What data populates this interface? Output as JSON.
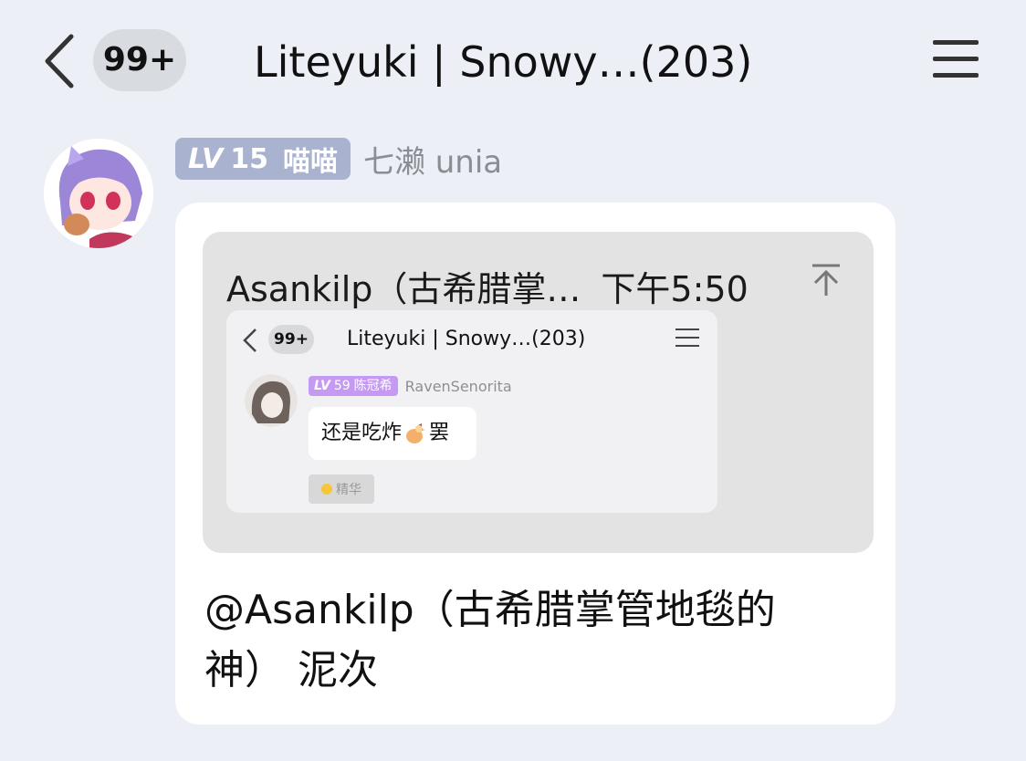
{
  "header": {
    "unread_badge": "99+",
    "title": "Liteyuki | Snowy…(203)"
  },
  "message": {
    "level": "LV",
    "level_num": "15",
    "member_title": "喵喵",
    "sender_name": "七濑 unia",
    "quote": {
      "author": "Asankilp（古希腊掌…",
      "time": "下午5:50",
      "screenshot": {
        "unread_badge": "99+",
        "title": "Liteyuki | Snowy…(203)",
        "level": "LV",
        "level_num": "59",
        "member_title": "陈冠希",
        "sender_name": "RavenSenorita",
        "text_before": "还是吃炸",
        "text_after": "罢",
        "tag": "精华"
      }
    },
    "text_line1": "@Asankilp（古希腊掌管地毯的",
    "text_line2": "神） 泥次"
  },
  "colors": {
    "background": "#eceff5",
    "level_badge": "#a9b3cf",
    "inner_level_badge": "#c49af2"
  }
}
